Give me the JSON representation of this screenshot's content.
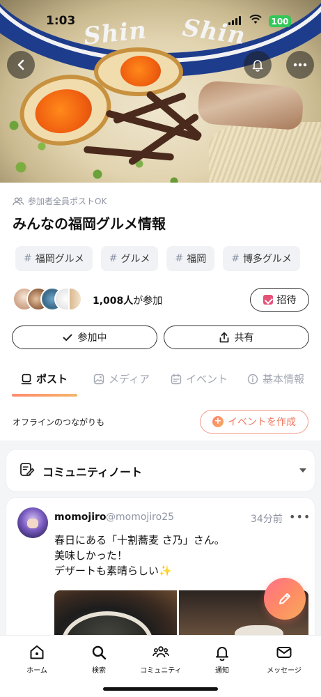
{
  "status_bar": {
    "time": "1:03",
    "battery": "100"
  },
  "hero": {
    "rim_text_left": "Shin",
    "rim_text_right": "Shin"
  },
  "community": {
    "permission": "参加者全員ポストOK",
    "title": "みんなの福岡グルメ情報",
    "tags": [
      "福岡グルメ",
      "グルメ",
      "福岡",
      "博多グルメ"
    ],
    "tag_prefix": "#",
    "member_count": "1,008人",
    "member_suffix": "が参加",
    "invite_label": "招待",
    "joined_label": "参加中",
    "share_label": "共有"
  },
  "tabs": [
    {
      "label": "ポスト",
      "active": true
    },
    {
      "label": "メディア",
      "active": false
    },
    {
      "label": "イベント",
      "active": false
    },
    {
      "label": "基本情報",
      "active": false
    }
  ],
  "offline_text": "オフラインのつながりも",
  "create_event_label": "イベントを作成",
  "community_note_label": "コミュニティノート",
  "post": {
    "username": "momojiro",
    "handle": "@momojiro25",
    "time": "34分前",
    "more": "•••",
    "body_lines": [
      "春日にある「十割蕎麦 さ乃」さん。",
      "美味しかった！",
      "デザートも素晴らしい✨"
    ]
  },
  "bottom_nav": [
    {
      "label": "ホーム",
      "icon": "home-icon"
    },
    {
      "label": "検索",
      "icon": "search-icon"
    },
    {
      "label": "コミュニティ",
      "icon": "community-icon"
    },
    {
      "label": "通知",
      "icon": "bell-icon"
    },
    {
      "label": "メッセージ",
      "icon": "mail-icon"
    }
  ],
  "colors": {
    "accent_start": "#ff6f8a",
    "accent_end": "#f6ac5c",
    "battery": "#34c759",
    "muted": "#8f94a3"
  }
}
